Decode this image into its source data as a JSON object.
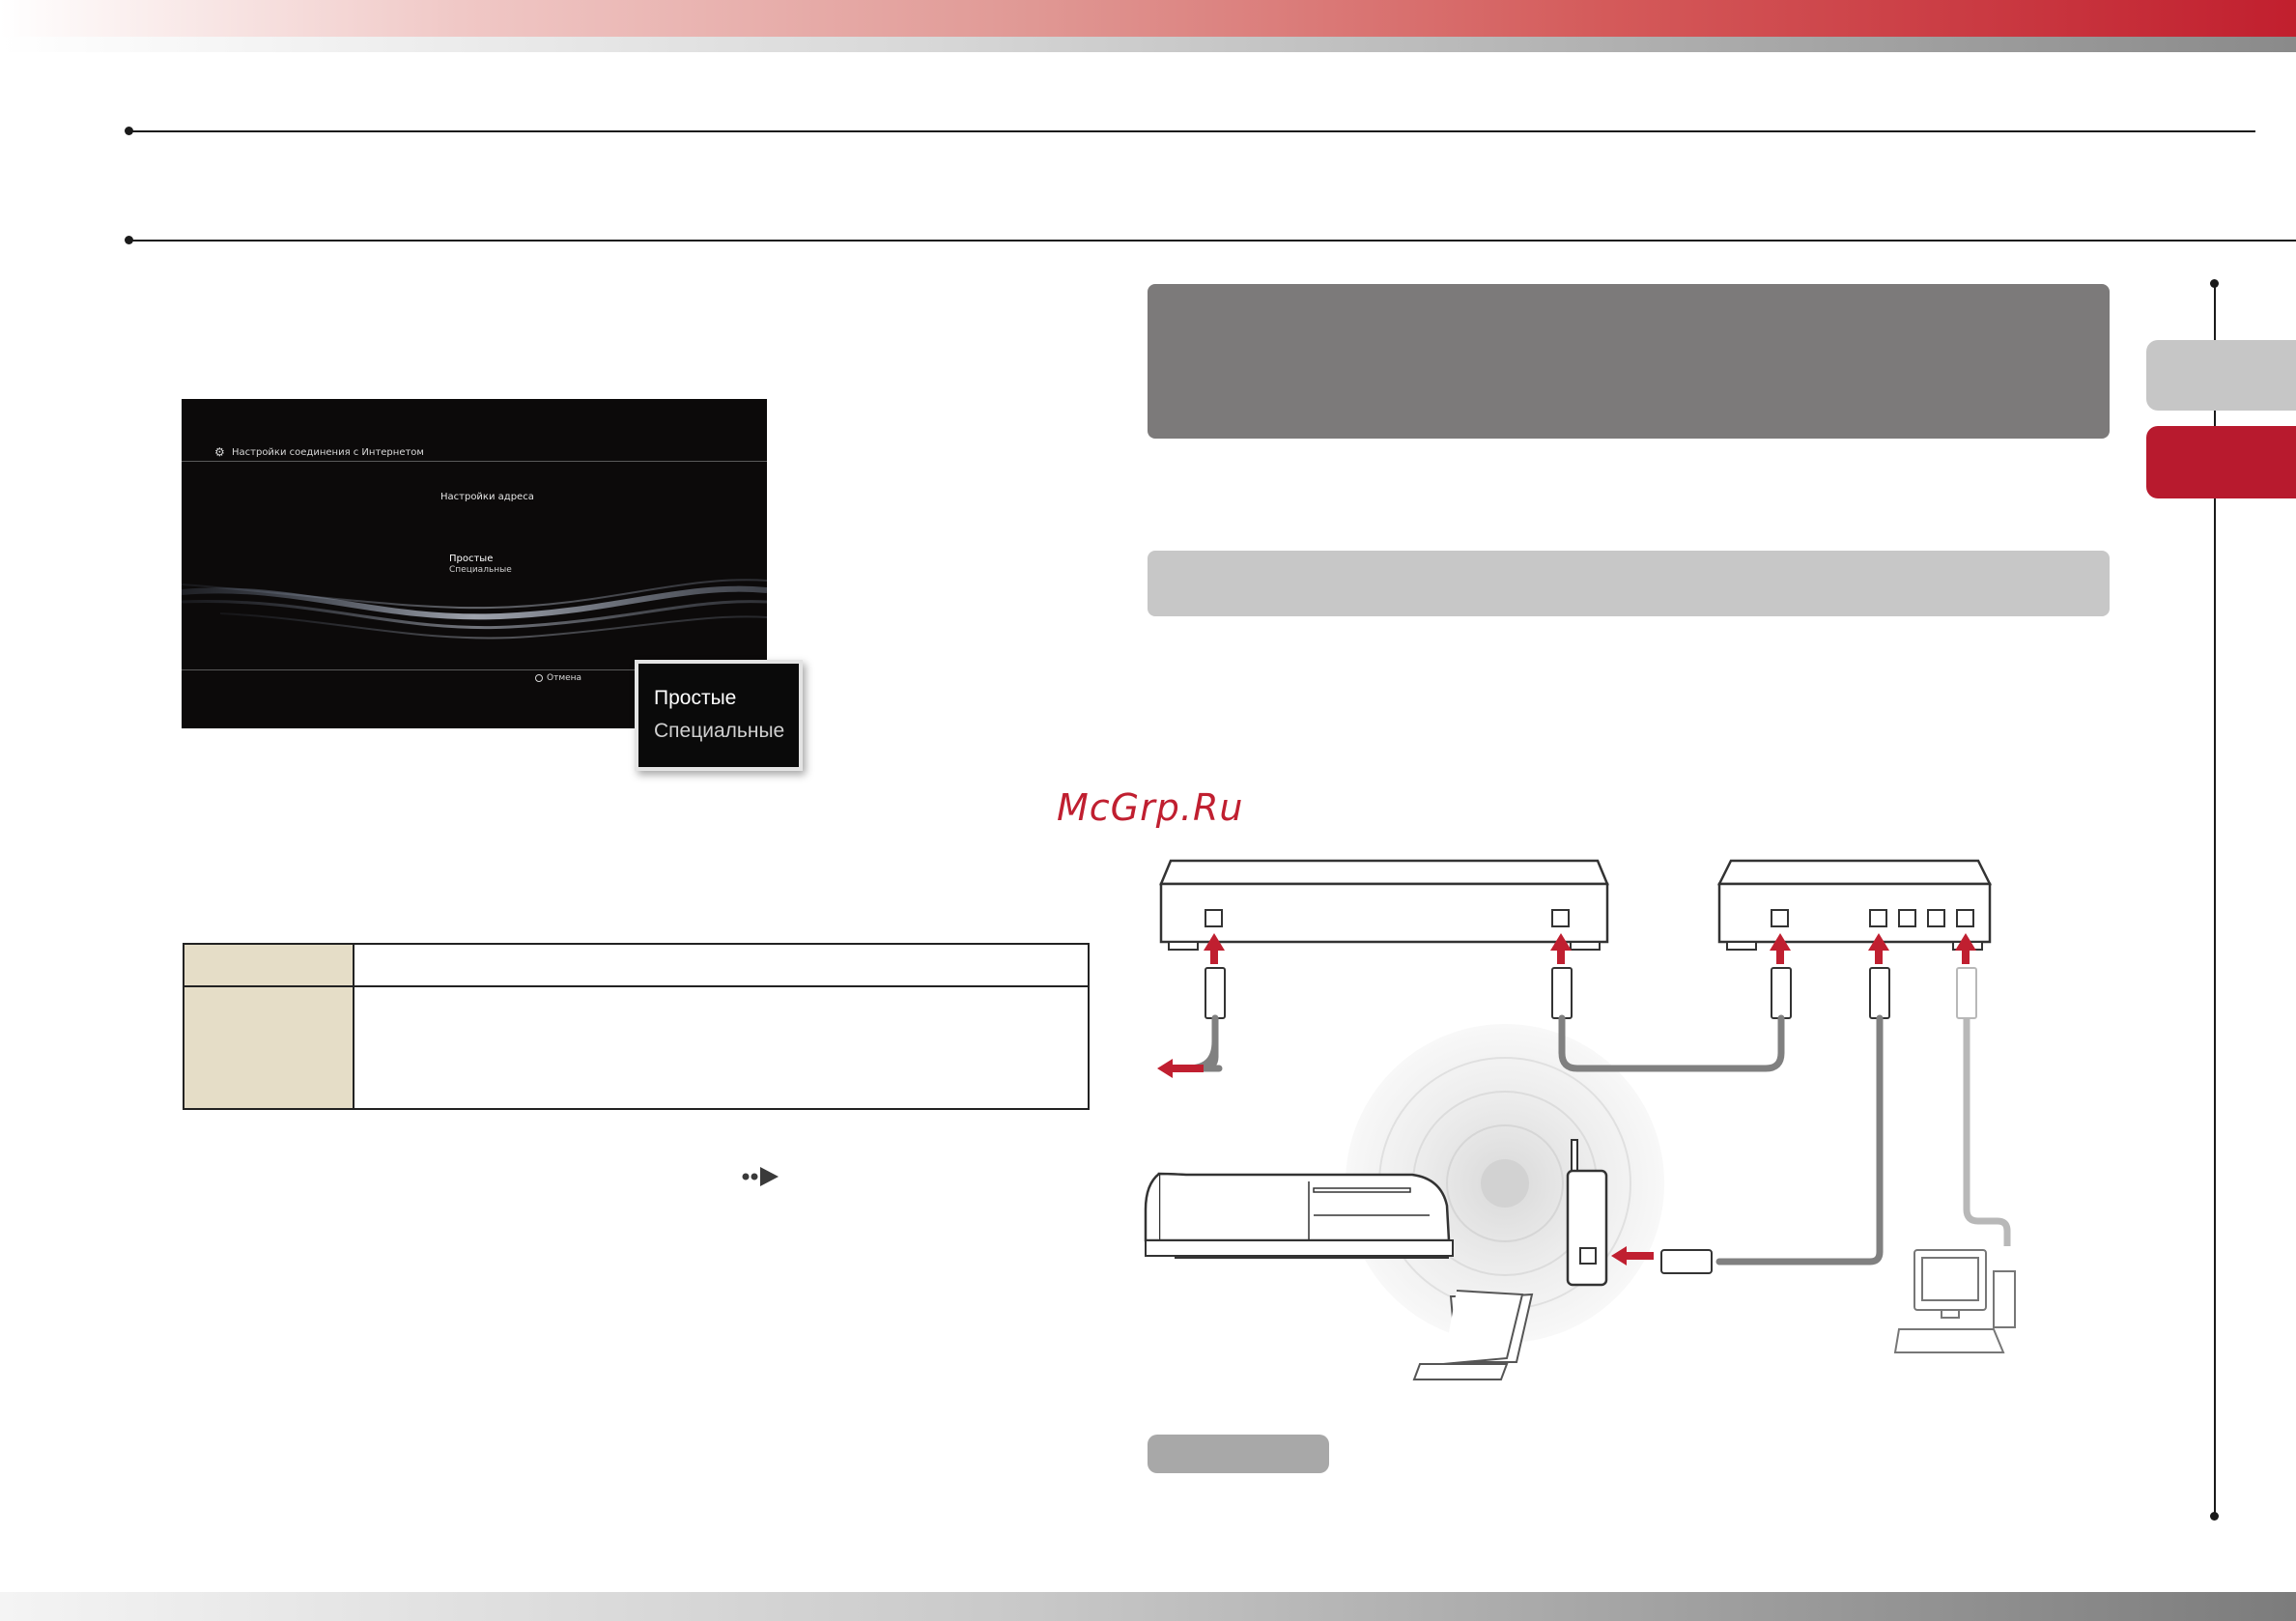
{
  "ps3_screen": {
    "title": "Настройки соединения с Интернетом",
    "heading": "Настройки адреса",
    "option_1": "Простые",
    "option_2": "Специальные",
    "cancel": "Отмена"
  },
  "zoom_popup": {
    "option_1": "Простые",
    "option_2": "Специальные"
  },
  "watermark": "McGrp.Ru",
  "colors": {
    "brand_red": "#b81a2e",
    "arrow_red": "#c01f30",
    "table_fill": "#e5ddc7",
    "header_gray": "#7c7a7a"
  },
  "icons": {
    "next_page": "next-page-arrow-icon",
    "settings": "network-settings-icon",
    "cancel": "circle-button-icon"
  }
}
